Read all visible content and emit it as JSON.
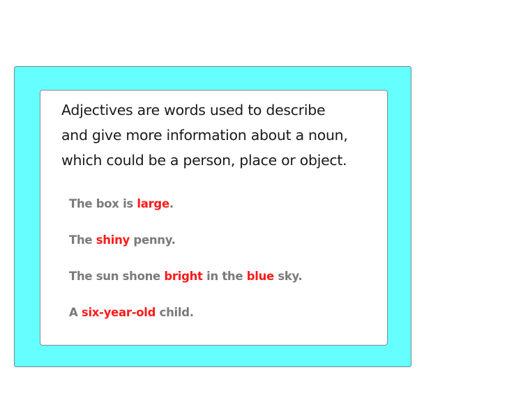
{
  "definition": {
    "line1": "Adjectives are words used to describe",
    "line2": "and give more information about a noun,",
    "line3": "which could be a person, place or object."
  },
  "examples": [
    [
      {
        "text": "The box is ",
        "adjective": false
      },
      {
        "text": "large",
        "adjective": true
      },
      {
        "text": ".",
        "adjective": false
      }
    ],
    [
      {
        "text": "The ",
        "adjective": false
      },
      {
        "text": "shiny",
        "adjective": true
      },
      {
        "text": " penny.",
        "adjective": false
      }
    ],
    [
      {
        "text": "The sun shone ",
        "adjective": false
      },
      {
        "text": "bright",
        "adjective": true
      },
      {
        "text": " in the ",
        "adjective": false
      },
      {
        "text": "blue",
        "adjective": true
      },
      {
        "text": " sky.",
        "adjective": false
      }
    ],
    [
      {
        "text": "A ",
        "adjective": false
      },
      {
        "text": "six-year-old",
        "adjective": true
      },
      {
        "text": " child.",
        "adjective": false
      }
    ]
  ],
  "colors": {
    "panel_background": "#66ffff",
    "adjective_highlight": "#ff1a1a",
    "sentence_text": "#7a7a7a",
    "definition_text": "#1a1a1a"
  }
}
